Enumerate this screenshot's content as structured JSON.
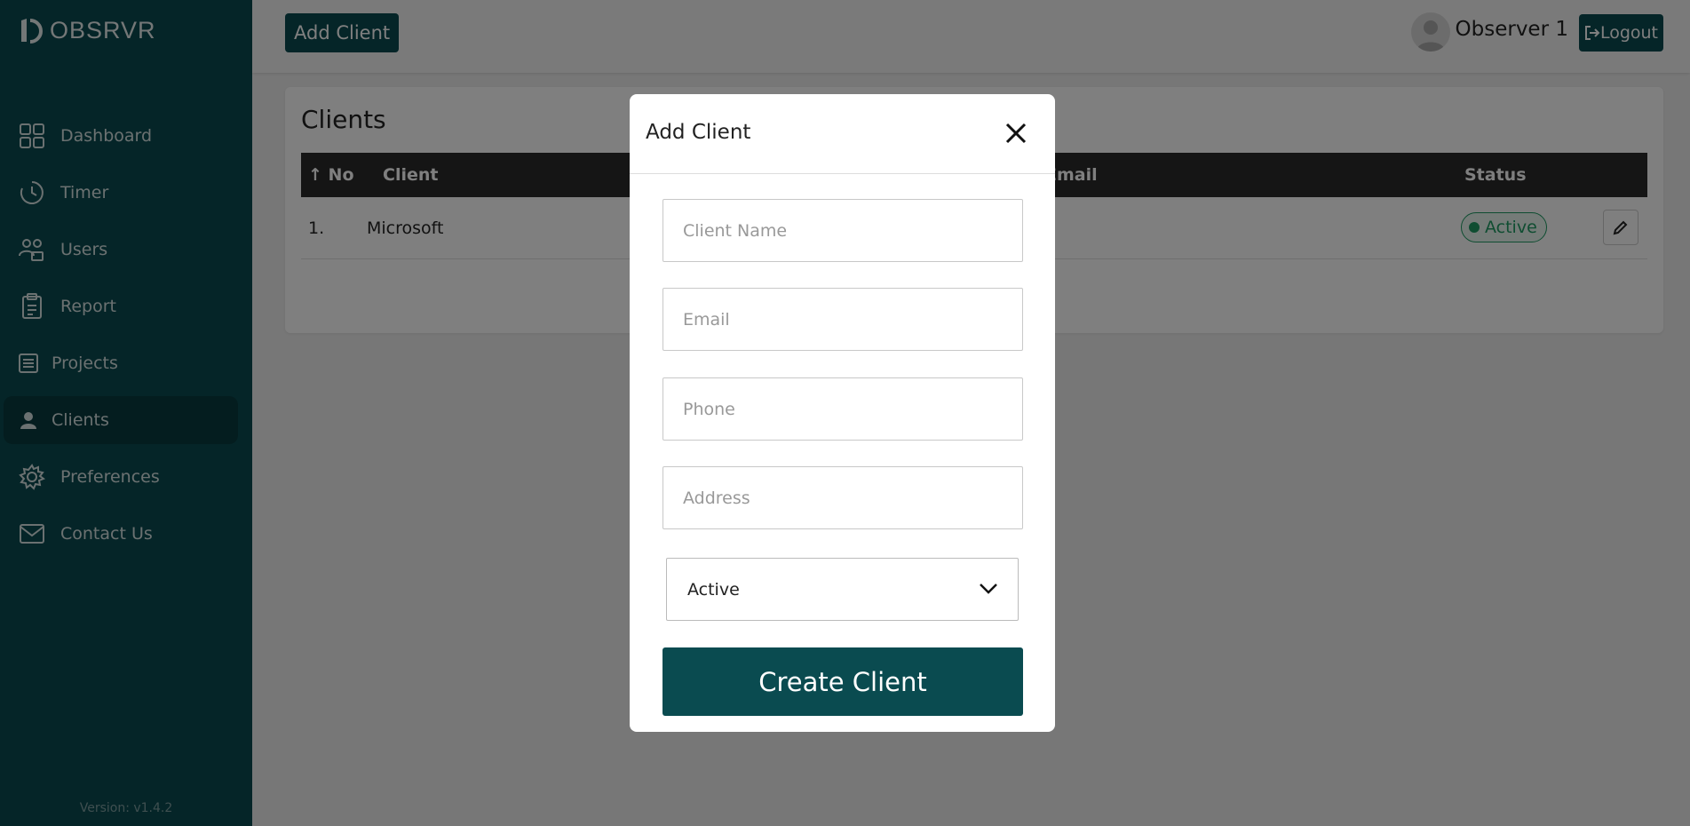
{
  "app": {
    "logo_text": "OBSRVR",
    "version": "Version: v1.4.2"
  },
  "sidebar": {
    "items": [
      {
        "label": "Dashboard",
        "icon": "dashboard-icon"
      },
      {
        "label": "Timer",
        "icon": "clock-icon"
      },
      {
        "label": "Users",
        "icon": "users-icon"
      },
      {
        "label": "Report",
        "icon": "clipboard-icon"
      },
      {
        "label": "Projects",
        "icon": "list-icon"
      },
      {
        "label": "Clients",
        "icon": "person-icon",
        "active": true
      },
      {
        "label": "Preferences",
        "icon": "gear-icon"
      },
      {
        "label": "Contact Us",
        "icon": "mail-icon"
      }
    ]
  },
  "topbar": {
    "add_client_label": "Add Client",
    "username": "Observer 1",
    "logout_label": "Logout"
  },
  "page": {
    "title": "Clients",
    "table": {
      "columns": [
        "No",
        "Client",
        "Email",
        "Status"
      ],
      "rows": [
        {
          "no": "1.",
          "client": "Microsoft",
          "status": "Active"
        }
      ]
    }
  },
  "modal": {
    "title": "Add Client",
    "fields": {
      "client_name_placeholder": "Client Name",
      "email_placeholder": "Email",
      "phone_placeholder": "Phone",
      "address_placeholder": "Address"
    },
    "status_value": "Active",
    "submit_label": "Create Client"
  },
  "colors": {
    "brand": "#0a4b50",
    "status_active": "#1e9a63"
  }
}
